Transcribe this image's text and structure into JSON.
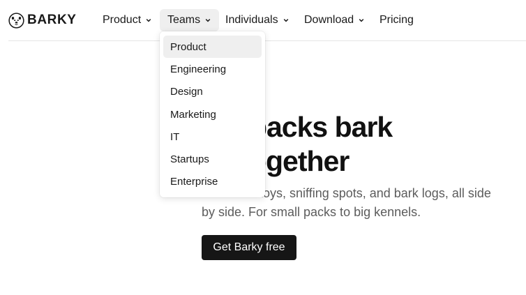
{
  "brand": {
    "name": "BARKY"
  },
  "nav": {
    "items": [
      {
        "label": "Product",
        "has_menu": true
      },
      {
        "label": "Teams",
        "has_menu": true,
        "active": true
      },
      {
        "label": "Individuals",
        "has_menu": true
      },
      {
        "label": "Download",
        "has_menu": true
      },
      {
        "label": "Pricing",
        "has_menu": false
      }
    ]
  },
  "dropdown": {
    "items": [
      {
        "label": "Product",
        "highlighted": true
      },
      {
        "label": "Engineering"
      },
      {
        "label": "Design"
      },
      {
        "label": "Marketing"
      },
      {
        "label": "IT"
      },
      {
        "label": "Startups"
      },
      {
        "label": "Enterprise"
      }
    ]
  },
  "hero": {
    "title_line1": "ere packs bark",
    "title_line2": "er, together",
    "subtitle_line1": "toys, sniffing spots, and bark logs, all side",
    "subtitle_line2": "by side. For small packs to big kennels.",
    "cta_label": "Get Barky free"
  },
  "colors": {
    "text": "#191919",
    "muted": "#5c5c5c",
    "cta_bg": "#161616",
    "hover_bg": "#efefef",
    "border": "#e4e4e4"
  }
}
